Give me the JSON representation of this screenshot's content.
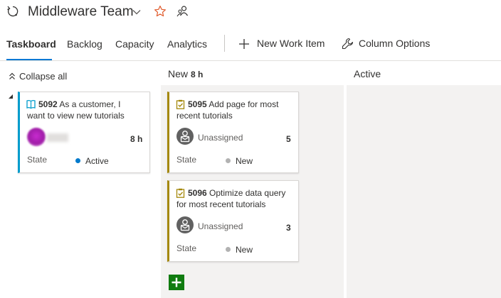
{
  "header": {
    "team_name": "Middleware Team"
  },
  "tabs": [
    {
      "label": "Taskboard",
      "active": true
    },
    {
      "label": "Backlog"
    },
    {
      "label": "Capacity"
    },
    {
      "label": "Analytics"
    }
  ],
  "commands": {
    "new_work_item": "New Work Item",
    "column_options": "Column Options"
  },
  "collapse_all": "Collapse all",
  "columns": [
    {
      "name": "New",
      "count": "8 h"
    },
    {
      "name": "Active",
      "count": ""
    }
  ],
  "story": {
    "id": "5092",
    "title": "As a customer, I want to view new tutorials",
    "effort": "8 h",
    "state_label": "State",
    "state": "Active"
  },
  "tasks": [
    {
      "id": "5095",
      "title": "Add page for most recent tutorials",
      "assignee": "Unassigned",
      "effort": "5",
      "state_label": "State",
      "state": "New"
    },
    {
      "id": "5096",
      "title": "Optimize data query for most recent tutorials",
      "assignee": "Unassigned",
      "effort": "3",
      "state_label": "State",
      "state": "New"
    }
  ],
  "colors": {
    "accent": "#0078d4",
    "story_bar": "#009ccc",
    "task_bar": "#a4880a",
    "state_active": "#007acc",
    "state_new": "#b2b2b2",
    "add_button": "#107c10",
    "favorite_star": "#e05a2b"
  },
  "icons": {
    "team": "team-refresh-icon",
    "favorite": "star-icon",
    "members": "people-icon",
    "add": "plus-icon",
    "settings": "wrench-icon",
    "story": "book-icon",
    "task": "clipboard-icon"
  }
}
